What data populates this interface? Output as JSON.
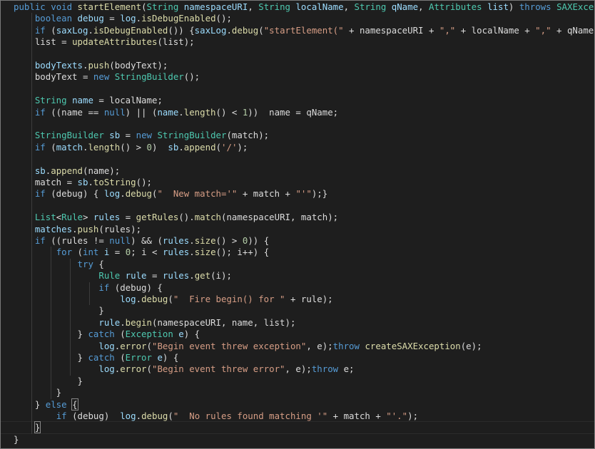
{
  "editor": {
    "lines": [
      [
        [
          "kw",
          "public"
        ],
        [
          "pl",
          " "
        ],
        [
          "kw",
          "void"
        ],
        [
          "pl",
          " "
        ],
        [
          "fn",
          "startElement"
        ],
        [
          "pl",
          "("
        ],
        [
          "ty",
          "String"
        ],
        [
          "pl",
          " "
        ],
        [
          "var",
          "namespaceURI"
        ],
        [
          "pl",
          ", "
        ],
        [
          "ty",
          "String"
        ],
        [
          "pl",
          " "
        ],
        [
          "var",
          "localName"
        ],
        [
          "pl",
          ", "
        ],
        [
          "ty",
          "String"
        ],
        [
          "pl",
          " "
        ],
        [
          "var",
          "qName"
        ],
        [
          "pl",
          ", "
        ],
        [
          "ty",
          "Attributes"
        ],
        [
          "pl",
          " "
        ],
        [
          "var",
          "list"
        ],
        [
          "pl",
          ") "
        ],
        [
          "kw",
          "throws"
        ],
        [
          "pl",
          " "
        ],
        [
          "ty",
          "SAXException"
        ],
        [
          "pl",
          " {"
        ]
      ],
      [
        [
          "pl",
          "    "
        ],
        [
          "kw",
          "boolean"
        ],
        [
          "pl",
          " "
        ],
        [
          "var",
          "debug"
        ],
        [
          "pl",
          " = "
        ],
        [
          "var",
          "log"
        ],
        [
          "pl",
          "."
        ],
        [
          "fn",
          "isDebugEnabled"
        ],
        [
          "pl",
          "();"
        ]
      ],
      [
        [
          "pl",
          "    "
        ],
        [
          "kw",
          "if"
        ],
        [
          "pl",
          " ("
        ],
        [
          "var",
          "saxLog"
        ],
        [
          "pl",
          "."
        ],
        [
          "fn",
          "isDebugEnabled"
        ],
        [
          "pl",
          "()) {"
        ],
        [
          "var",
          "saxLog"
        ],
        [
          "pl",
          "."
        ],
        [
          "fn",
          "debug"
        ],
        [
          "pl",
          "("
        ],
        [
          "str",
          "\"startElement(\""
        ],
        [
          "pl",
          " + namespaceURI + "
        ],
        [
          "str",
          "\",\""
        ],
        [
          "pl",
          " + localName + "
        ],
        [
          "str",
          "\",\""
        ],
        [
          "pl",
          " + qName + "
        ],
        [
          "str",
          "\")\""
        ],
        [
          "pl",
          ");}"
        ]
      ],
      [
        [
          "pl",
          "    list = "
        ],
        [
          "fn",
          "updateAttributes"
        ],
        [
          "pl",
          "(list);"
        ]
      ],
      [],
      [
        [
          "pl",
          "    "
        ],
        [
          "var",
          "bodyTexts"
        ],
        [
          "pl",
          "."
        ],
        [
          "fn",
          "push"
        ],
        [
          "pl",
          "(bodyText);"
        ]
      ],
      [
        [
          "pl",
          "    bodyText = "
        ],
        [
          "kw",
          "new"
        ],
        [
          "pl",
          " "
        ],
        [
          "ty",
          "StringBuilder"
        ],
        [
          "pl",
          "();"
        ]
      ],
      [],
      [
        [
          "pl",
          "    "
        ],
        [
          "ty",
          "String"
        ],
        [
          "pl",
          " "
        ],
        [
          "var",
          "name"
        ],
        [
          "pl",
          " = localName;"
        ]
      ],
      [
        [
          "pl",
          "    "
        ],
        [
          "kw",
          "if"
        ],
        [
          "pl",
          " ((name == "
        ],
        [
          "kw",
          "null"
        ],
        [
          "pl",
          ") || ("
        ],
        [
          "var",
          "name"
        ],
        [
          "pl",
          "."
        ],
        [
          "fn",
          "length"
        ],
        [
          "pl",
          "() < "
        ],
        [
          "num",
          "1"
        ],
        [
          "pl",
          "))  name = qName;"
        ]
      ],
      [],
      [
        [
          "pl",
          "    "
        ],
        [
          "ty",
          "StringBuilder"
        ],
        [
          "pl",
          " "
        ],
        [
          "var",
          "sb"
        ],
        [
          "pl",
          " = "
        ],
        [
          "kw",
          "new"
        ],
        [
          "pl",
          " "
        ],
        [
          "ty",
          "StringBuilder"
        ],
        [
          "pl",
          "(match);"
        ]
      ],
      [
        [
          "pl",
          "    "
        ],
        [
          "kw",
          "if"
        ],
        [
          "pl",
          " ("
        ],
        [
          "var",
          "match"
        ],
        [
          "pl",
          "."
        ],
        [
          "fn",
          "length"
        ],
        [
          "pl",
          "() > "
        ],
        [
          "num",
          "0"
        ],
        [
          "pl",
          ")  "
        ],
        [
          "var",
          "sb"
        ],
        [
          "pl",
          "."
        ],
        [
          "fn",
          "append"
        ],
        [
          "pl",
          "("
        ],
        [
          "str",
          "'/'"
        ],
        [
          "pl",
          ");"
        ]
      ],
      [],
      [
        [
          "pl",
          "    "
        ],
        [
          "var",
          "sb"
        ],
        [
          "pl",
          "."
        ],
        [
          "fn",
          "append"
        ],
        [
          "pl",
          "(name);"
        ]
      ],
      [
        [
          "pl",
          "    match = "
        ],
        [
          "var",
          "sb"
        ],
        [
          "pl",
          "."
        ],
        [
          "fn",
          "toString"
        ],
        [
          "pl",
          "();"
        ]
      ],
      [
        [
          "pl",
          "    "
        ],
        [
          "kw",
          "if"
        ],
        [
          "pl",
          " (debug) { "
        ],
        [
          "var",
          "log"
        ],
        [
          "pl",
          "."
        ],
        [
          "fn",
          "debug"
        ],
        [
          "pl",
          "("
        ],
        [
          "str",
          "\"  New match='\""
        ],
        [
          "pl",
          " + match + "
        ],
        [
          "str",
          "\"'\""
        ],
        [
          "pl",
          ");}"
        ]
      ],
      [],
      [
        [
          "pl",
          "    "
        ],
        [
          "ty",
          "List"
        ],
        [
          "pl",
          "<"
        ],
        [
          "ty",
          "Rule"
        ],
        [
          "pl",
          "> "
        ],
        [
          "var",
          "rules"
        ],
        [
          "pl",
          " = "
        ],
        [
          "fn",
          "getRules"
        ],
        [
          "pl",
          "()."
        ],
        [
          "fn",
          "match"
        ],
        [
          "pl",
          "(namespaceURI, match);"
        ]
      ],
      [
        [
          "pl",
          "    "
        ],
        [
          "var",
          "matches"
        ],
        [
          "pl",
          "."
        ],
        [
          "fn",
          "push"
        ],
        [
          "pl",
          "(rules);"
        ]
      ],
      [
        [
          "pl",
          "    "
        ],
        [
          "kw",
          "if"
        ],
        [
          "pl",
          " ((rules != "
        ],
        [
          "kw",
          "null"
        ],
        [
          "pl",
          ") && ("
        ],
        [
          "var",
          "rules"
        ],
        [
          "pl",
          "."
        ],
        [
          "fn",
          "size"
        ],
        [
          "pl",
          "() > "
        ],
        [
          "num",
          "0"
        ],
        [
          "pl",
          ")) {"
        ]
      ],
      [
        [
          "pl",
          "        "
        ],
        [
          "kw",
          "for"
        ],
        [
          "pl",
          " ("
        ],
        [
          "kw",
          "int"
        ],
        [
          "pl",
          " "
        ],
        [
          "var",
          "i"
        ],
        [
          "pl",
          " = "
        ],
        [
          "num",
          "0"
        ],
        [
          "pl",
          "; i < "
        ],
        [
          "var",
          "rules"
        ],
        [
          "pl",
          "."
        ],
        [
          "fn",
          "size"
        ],
        [
          "pl",
          "(); i++) {"
        ]
      ],
      [
        [
          "pl",
          "            "
        ],
        [
          "kw",
          "try"
        ],
        [
          "pl",
          " {"
        ]
      ],
      [
        [
          "pl",
          "                "
        ],
        [
          "ty",
          "Rule"
        ],
        [
          "pl",
          " "
        ],
        [
          "var",
          "rule"
        ],
        [
          "pl",
          " = "
        ],
        [
          "var",
          "rules"
        ],
        [
          "pl",
          "."
        ],
        [
          "fn",
          "get"
        ],
        [
          "pl",
          "(i);"
        ]
      ],
      [
        [
          "pl",
          "                "
        ],
        [
          "kw",
          "if"
        ],
        [
          "pl",
          " (debug) {"
        ]
      ],
      [
        [
          "pl",
          "                    "
        ],
        [
          "var",
          "log"
        ],
        [
          "pl",
          "."
        ],
        [
          "fn",
          "debug"
        ],
        [
          "pl",
          "("
        ],
        [
          "str",
          "\"  Fire begin() for \""
        ],
        [
          "pl",
          " + rule);"
        ]
      ],
      [
        [
          "pl",
          "                }"
        ]
      ],
      [
        [
          "pl",
          "                "
        ],
        [
          "var",
          "rule"
        ],
        [
          "pl",
          "."
        ],
        [
          "fn",
          "begin"
        ],
        [
          "pl",
          "(namespaceURI, name, list);"
        ]
      ],
      [
        [
          "pl",
          "            } "
        ],
        [
          "kw",
          "catch"
        ],
        [
          "pl",
          " ("
        ],
        [
          "ty",
          "Exception"
        ],
        [
          "pl",
          " "
        ],
        [
          "var",
          "e"
        ],
        [
          "pl",
          ") {"
        ]
      ],
      [
        [
          "pl",
          "                "
        ],
        [
          "var",
          "log"
        ],
        [
          "pl",
          "."
        ],
        [
          "fn",
          "error"
        ],
        [
          "pl",
          "("
        ],
        [
          "str",
          "\"Begin event threw exception\""
        ],
        [
          "pl",
          ", e);"
        ],
        [
          "kw",
          "throw"
        ],
        [
          "pl",
          " "
        ],
        [
          "fn",
          "createSAXException"
        ],
        [
          "pl",
          "(e);"
        ]
      ],
      [
        [
          "pl",
          "            } "
        ],
        [
          "kw",
          "catch"
        ],
        [
          "pl",
          " ("
        ],
        [
          "ty",
          "Error"
        ],
        [
          "pl",
          " "
        ],
        [
          "var",
          "e"
        ],
        [
          "pl",
          ") {"
        ]
      ],
      [
        [
          "pl",
          "                "
        ],
        [
          "var",
          "log"
        ],
        [
          "pl",
          "."
        ],
        [
          "fn",
          "error"
        ],
        [
          "pl",
          "("
        ],
        [
          "str",
          "\"Begin event threw error\""
        ],
        [
          "pl",
          ", e);"
        ],
        [
          "kw",
          "throw"
        ],
        [
          "pl",
          " e;"
        ]
      ],
      [
        [
          "pl",
          "            }"
        ]
      ],
      [
        [
          "pl",
          "        }"
        ]
      ],
      [
        [
          "pl",
          "    } "
        ],
        [
          "kw",
          "else"
        ],
        [
          "pl",
          " "
        ],
        [
          "br",
          "{"
        ]
      ],
      [
        [
          "pl",
          "        "
        ],
        [
          "kw",
          "if"
        ],
        [
          "pl",
          " (debug)  "
        ],
        [
          "var",
          "log"
        ],
        [
          "pl",
          "."
        ],
        [
          "fn",
          "debug"
        ],
        [
          "pl",
          "("
        ],
        [
          "str",
          "\"  No rules found matching '\""
        ],
        [
          "pl",
          " + match + "
        ],
        [
          "str",
          "\"'.\""
        ],
        [
          "pl",
          ");"
        ]
      ],
      [
        [
          "pl",
          "    "
        ],
        [
          "br",
          "}"
        ]
      ],
      [
        [
          "pl",
          "}"
        ]
      ]
    ]
  }
}
